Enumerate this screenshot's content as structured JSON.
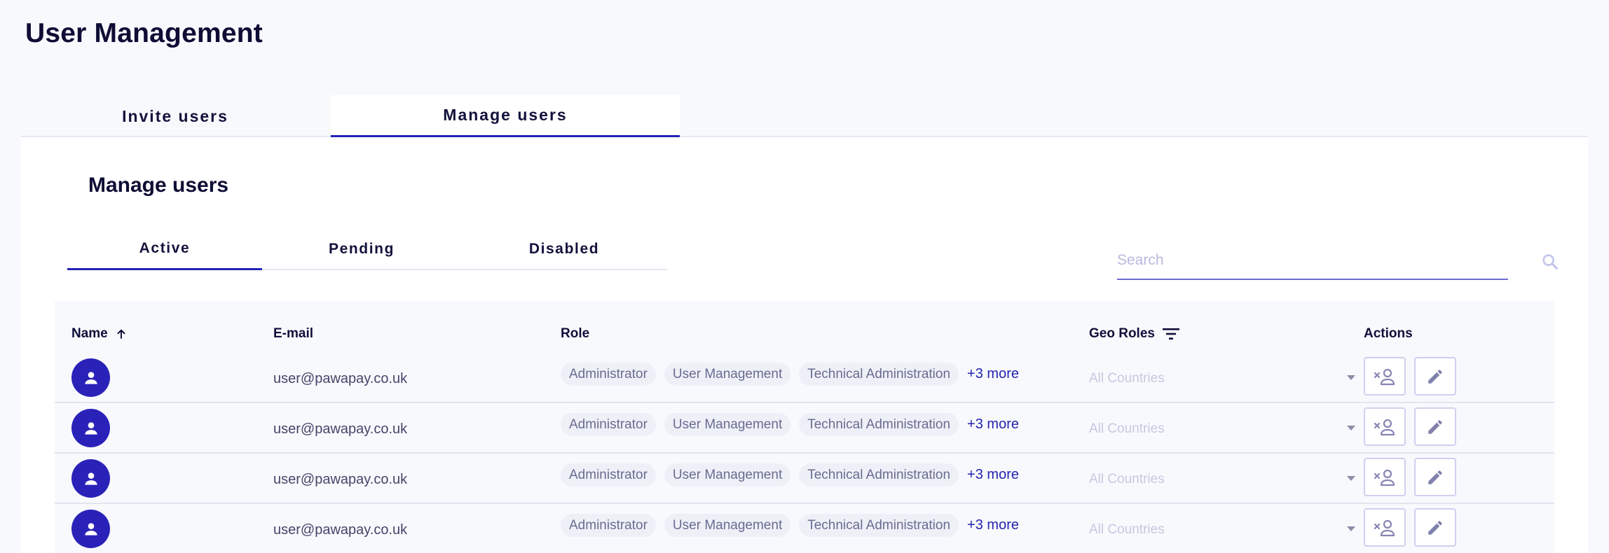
{
  "page": {
    "title": "User Management"
  },
  "top_tabs": [
    {
      "label": "Invite users",
      "active": false
    },
    {
      "label": "Manage users",
      "active": true
    }
  ],
  "card": {
    "title": "Manage users"
  },
  "status_tabs": [
    {
      "label": "Active",
      "active": true
    },
    {
      "label": "Pending",
      "active": false
    },
    {
      "label": "Disabled",
      "active": false
    }
  ],
  "search": {
    "placeholder": "Search",
    "value": "",
    "icon": "search-icon"
  },
  "table": {
    "columns": [
      {
        "label": "Name",
        "icon": "sort-ascending-icon"
      },
      {
        "label": "E-mail"
      },
      {
        "label": "Role"
      },
      {
        "label": "Geo Roles",
        "icon": "filter-icon"
      },
      {
        "label": "Actions"
      }
    ],
    "rows": [
      {
        "email": "user@pawapay.co.uk",
        "roles": [
          "Administrator",
          "User Management",
          "Technical Administration"
        ],
        "more": "+3 more",
        "geo": "All Countries"
      },
      {
        "email": "user@pawapay.co.uk",
        "roles": [
          "Administrator",
          "User Management",
          "Technical Administration"
        ],
        "more": "+3 more",
        "geo": "All Countries"
      },
      {
        "email": "user@pawapay.co.uk",
        "roles": [
          "Administrator",
          "User Management",
          "Technical Administration"
        ],
        "more": "+3 more",
        "geo": "All Countries"
      },
      {
        "email": "user@pawapay.co.uk",
        "roles": [
          "Administrator",
          "User Management",
          "Technical Administration"
        ],
        "more": "+3 more",
        "geo": "All Countries"
      }
    ]
  },
  "colors": {
    "accent": "#2424b8",
    "avatar": "#2a22b8",
    "chip_bg": "#eef0f8",
    "page_bg": "#f8f9fd"
  }
}
